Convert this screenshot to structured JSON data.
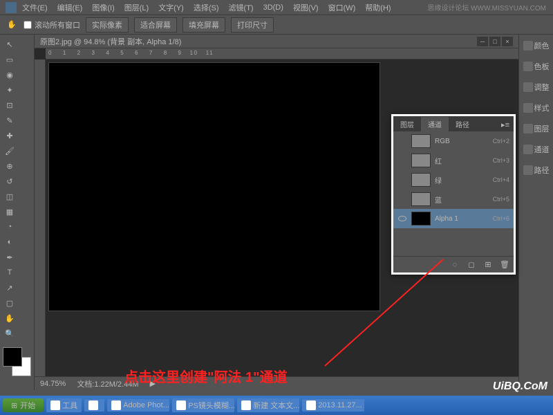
{
  "menubar": {
    "items": [
      "文件(E)",
      "编辑(E)",
      "图像(I)",
      "图层(L)",
      "文字(Y)",
      "选择(S)",
      "滤镜(T)",
      "3D(D)",
      "视图(V)",
      "窗口(W)",
      "帮助(H)"
    ]
  },
  "watermark_top": "思缘设计论坛  WWW.MISSYUAN.COM",
  "options_bar": {
    "scroll_all": "滚动所有窗口",
    "actual_pixels": "实际像素",
    "fit_screen": "适合屏幕",
    "fill_screen": "填充屏幕",
    "print_size": "打印尺寸"
  },
  "document": {
    "title": "原图2.jpg @ 94.8% (背景 副本, Alpha 1/8)",
    "zoom": "94.75%",
    "doc_info": "文档:1.22M/2.44M"
  },
  "right_dock": [
    {
      "icon": "color",
      "label": "颜色"
    },
    {
      "icon": "swatch",
      "label": "色板"
    },
    {
      "icon": "adjust",
      "label": "调整"
    },
    {
      "icon": "styles",
      "label": "样式"
    },
    {
      "icon": "layers",
      "label": "图层"
    },
    {
      "icon": "channels",
      "label": "通道"
    },
    {
      "icon": "paths",
      "label": "路径"
    }
  ],
  "channels_panel": {
    "tabs": [
      "图层",
      "通道",
      "路径"
    ],
    "active_tab": 1,
    "channels": [
      {
        "name": "RGB",
        "shortcut": "Ctrl+2",
        "visible": false,
        "thumb": "img"
      },
      {
        "name": "红",
        "shortcut": "Ctrl+3",
        "visible": false,
        "thumb": "img"
      },
      {
        "name": "绿",
        "shortcut": "Ctrl+4",
        "visible": false,
        "thumb": "img"
      },
      {
        "name": "蓝",
        "shortcut": "Ctrl+5",
        "visible": false,
        "thumb": "img"
      },
      {
        "name": "Alpha 1",
        "shortcut": "Ctrl+6",
        "visible": true,
        "thumb": "alpha",
        "selected": true
      }
    ]
  },
  "annotation_text": "点击这里创建\"阿法 1\"通道",
  "taskbar": {
    "start": "开始",
    "items": [
      "工具",
      "",
      "Adobe Phot...",
      "PS镜头模糊...",
      "新建 文本文...",
      "2013.11.27..."
    ]
  },
  "watermark_br": "UiBQ.CoM"
}
